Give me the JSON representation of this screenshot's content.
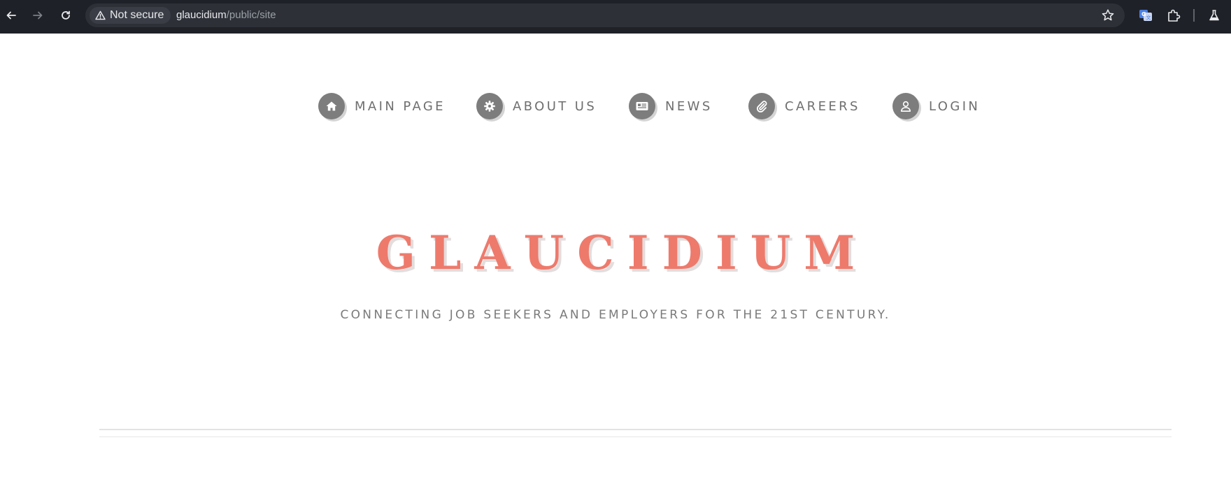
{
  "browser": {
    "security_label": "Not secure",
    "url_host": "glaucidium",
    "url_path": "/public/site",
    "icons": {
      "back": "arrow-left-icon",
      "forward": "arrow-right-icon",
      "reload": "reload-icon",
      "warning": "warning-triangle-icon",
      "bookmark": "star-icon",
      "translate": "translate-icon",
      "extensions": "puzzle-icon",
      "labs": "flask-icon"
    }
  },
  "nav": {
    "items": [
      {
        "label": "MAIN PAGE",
        "icon": "home-icon"
      },
      {
        "label": "ABOUT US",
        "icon": "gear-icon"
      },
      {
        "label": "NEWS",
        "icon": "newspaper-icon"
      },
      {
        "label": "CAREERS",
        "icon": "paperclip-icon"
      },
      {
        "label": "LOGIN",
        "icon": "user-icon"
      }
    ]
  },
  "hero": {
    "title": "GLAUCIDIUM",
    "subtitle": "CONNECTING JOB SEEKERS AND EMPLOYERS FOR THE 21ST CENTURY."
  },
  "colors": {
    "title": "#ee7a6c",
    "nav_icon_bg": "#7d7d7d",
    "nav_text": "#6f6f6f",
    "chrome_bg": "#1f2128"
  }
}
